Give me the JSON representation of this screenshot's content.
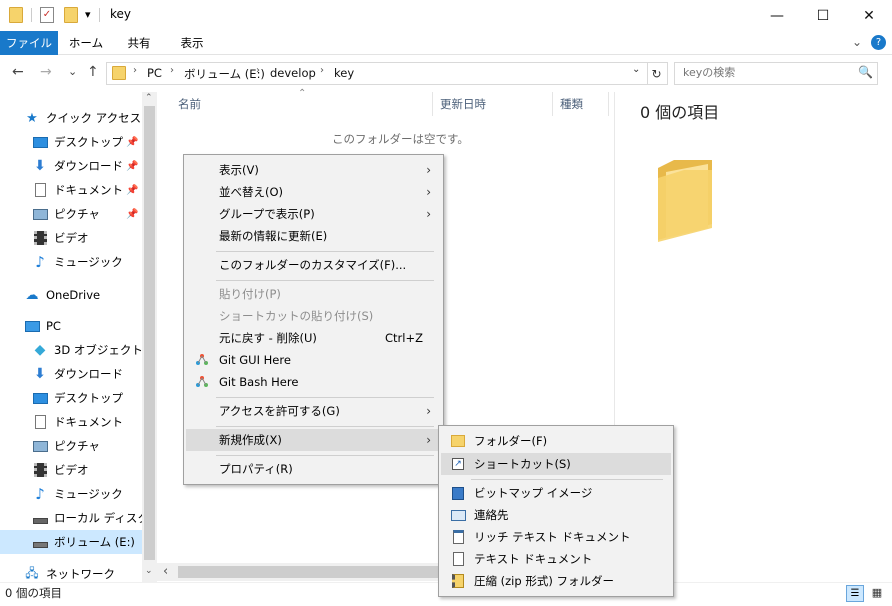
{
  "window": {
    "title": "key",
    "minimize": "—",
    "maximize": "☐",
    "close": "✕",
    "qa_dropdown": "▾"
  },
  "ribbon": {
    "tabs": [
      "ファイル",
      "ホーム",
      "共有",
      "表示"
    ],
    "collapse": "⌄",
    "help": "?"
  },
  "address": {
    "back": "←",
    "forward": "→",
    "recent": "⌄",
    "up": "↑",
    "crumbs": [
      "PC",
      "ボリューム (E:)",
      "develop",
      "key"
    ],
    "sep": "›",
    "dropdown": "⌄",
    "refresh": "↻"
  },
  "search": {
    "placeholder": "keyの検索",
    "icon": "🔍"
  },
  "sidebar": {
    "quick_access": "クイック アクセス",
    "quick_items": [
      {
        "label": "デスクトップ",
        "icon": "desktop-icon"
      },
      {
        "label": "ダウンロード",
        "icon": "download-icon"
      },
      {
        "label": "ドキュメント",
        "icon": "document-icon"
      },
      {
        "label": "ピクチャ",
        "icon": "pictures-icon"
      },
      {
        "label": "ビデオ",
        "icon": "video-icon"
      },
      {
        "label": "ミュージック",
        "icon": "music-icon"
      }
    ],
    "pin": "📌",
    "onedrive": "OneDrive",
    "pc": "PC",
    "pc_items": [
      {
        "label": "3D オブジェクト",
        "icon": "3d-objects-icon"
      },
      {
        "label": "ダウンロード",
        "icon": "download-icon"
      },
      {
        "label": "デスクトップ",
        "icon": "desktop-icon"
      },
      {
        "label": "ドキュメント",
        "icon": "document-icon"
      },
      {
        "label": "ピクチャ",
        "icon": "pictures-icon"
      },
      {
        "label": "ビデオ",
        "icon": "video-icon"
      },
      {
        "label": "ミュージック",
        "icon": "music-icon"
      },
      {
        "label": "ローカル ディスク (C:)",
        "icon": "drive-c-icon"
      },
      {
        "label": "ボリューム (E:)",
        "icon": "drive-e-icon"
      }
    ],
    "network": "ネットワーク",
    "scroll_up": "⌃",
    "scroll_down": "⌄"
  },
  "columns": {
    "name": "名前",
    "modified": "更新日時",
    "type": "種類",
    "sort_arrow": "⌃"
  },
  "content": {
    "empty_message": "このフォルダーは空です。",
    "hscroll_left": "‹"
  },
  "preview": {
    "count": "0 個の項目"
  },
  "status": {
    "text": "0 個の項目"
  },
  "context_menu": {
    "items": [
      {
        "label": "表示(V)",
        "arrow": "›"
      },
      {
        "label": "並べ替え(O)",
        "arrow": "›"
      },
      {
        "label": "グループで表示(P)",
        "arrow": "›"
      },
      {
        "label": "最新の情報に更新(E)"
      },
      {
        "label": "このフォルダーのカスタマイズ(F)..."
      },
      {
        "label": "貼り付け(P)"
      },
      {
        "label": "ショートカットの貼り付け(S)"
      },
      {
        "label": "元に戻す - 削除(U)",
        "shortcut": "Ctrl+Z"
      },
      {
        "label": "Git GUI Here"
      },
      {
        "label": "Git Bash Here"
      },
      {
        "label": "アクセスを許可する(G)",
        "arrow": "›"
      },
      {
        "label": "新規作成(X)",
        "arrow": "›"
      },
      {
        "label": "プロパティ(R)"
      }
    ]
  },
  "submenu": {
    "items": [
      {
        "label": "フォルダー(F)"
      },
      {
        "label": "ショートカット(S)"
      },
      {
        "label": "ビットマップ イメージ"
      },
      {
        "label": "連絡先"
      },
      {
        "label": "リッチ テキスト ドキュメント"
      },
      {
        "label": "テキスト ドキュメント"
      },
      {
        "label": "圧縮 (zip 形式) フォルダー"
      }
    ]
  },
  "colors": {
    "accent": "#1979ca",
    "folder": "#f6d36b",
    "menu_bg": "#f2f2f2",
    "menu_highlight": "#dcdcdc"
  }
}
